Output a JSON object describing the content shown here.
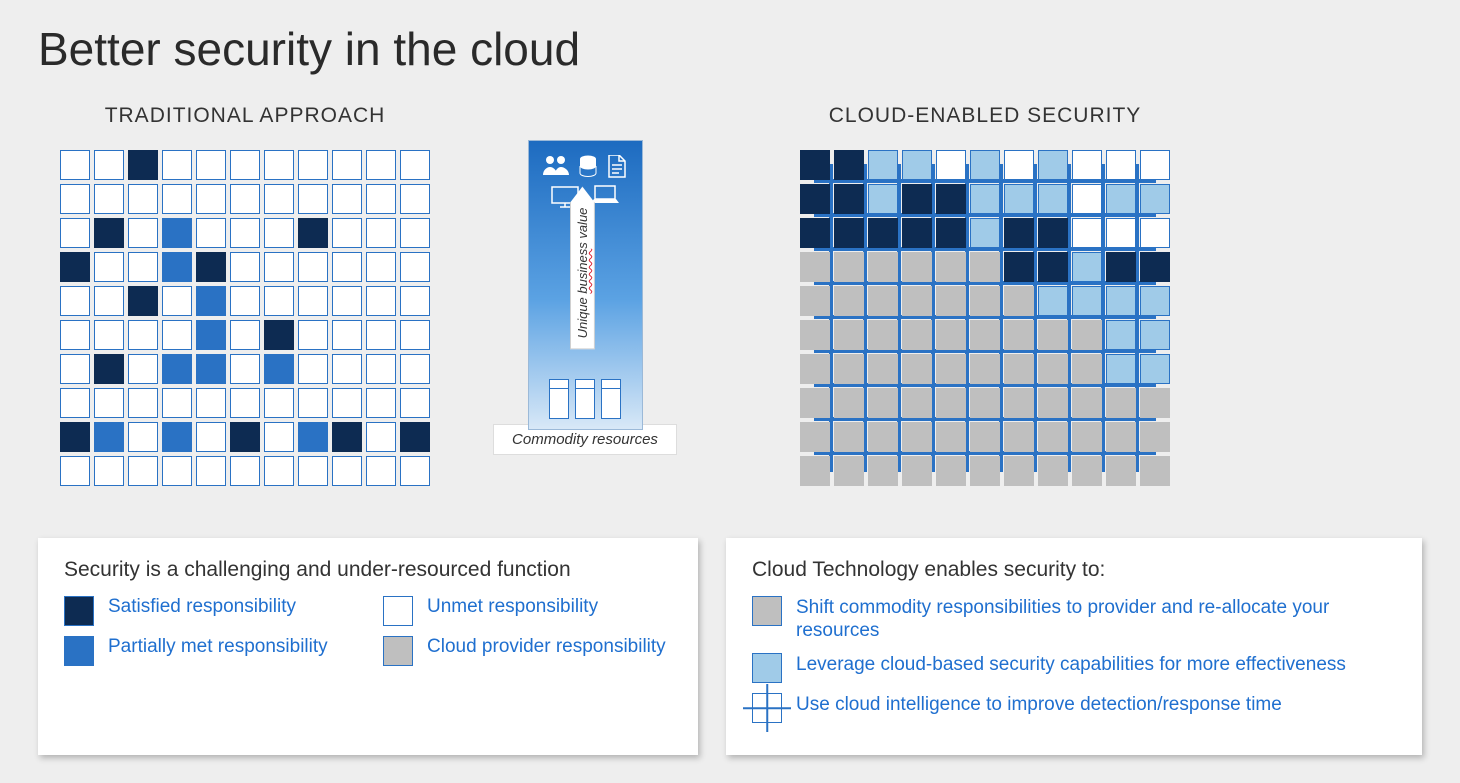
{
  "title": "Better security in the cloud",
  "columns": {
    "traditional": "TRADITIONAL APPROACH",
    "cloud": "CLOUD-ENABLED SECURITY"
  },
  "middle": {
    "vertical_label_prefix": "Unique ",
    "vertical_label_squiggle": "busines",
    "vertical_label_suffix": "s value",
    "commodity_label": "Commodity resources"
  },
  "left_card": {
    "title": "Security is a challenging and under-resourced function",
    "legend": [
      {
        "key": "satisfied",
        "label": "Satisfied responsibility",
        "swatch": "c-s"
      },
      {
        "key": "partial",
        "label": "Partially met responsibility",
        "swatch": "c-p"
      },
      {
        "key": "unmet",
        "label": "Unmet responsibility",
        "swatch": "c-u"
      },
      {
        "key": "provider",
        "label": "Cloud provider responsibility",
        "swatch": "c-g"
      }
    ]
  },
  "right_card": {
    "title": "Cloud Technology enables security to:",
    "bullets": [
      {
        "swatch": "c-g",
        "label": "Shift commodity responsibilities to provider and re-allocate your resources"
      },
      {
        "swatch": "c-l",
        "label": "Leverage cloud-based security capabilities for more effectiveness"
      },
      {
        "swatch": "intel",
        "label": "Use cloud intelligence to improve detection/response time"
      }
    ]
  },
  "grids": {
    "traditional": [
      [
        "u",
        "u",
        "s",
        "u",
        "u",
        "u",
        "u",
        "u",
        "u",
        "u",
        "u"
      ],
      [
        "u",
        "u",
        "u",
        "u",
        "u",
        "u",
        "u",
        "u",
        "u",
        "u",
        "u"
      ],
      [
        "u",
        "s",
        "u",
        "p",
        "u",
        "u",
        "u",
        "s",
        "u",
        "u",
        "u"
      ],
      [
        "s",
        "u",
        "u",
        "p",
        "s",
        "u",
        "u",
        "u",
        "u",
        "u",
        "u"
      ],
      [
        "u",
        "u",
        "s",
        "u",
        "p",
        "u",
        "u",
        "u",
        "u",
        "u",
        "u"
      ],
      [
        "u",
        "u",
        "u",
        "u",
        "p",
        "u",
        "s",
        "u",
        "u",
        "u",
        "u"
      ],
      [
        "u",
        "s",
        "u",
        "p",
        "p",
        "u",
        "p",
        "u",
        "u",
        "u",
        "u"
      ],
      [
        "u",
        "u",
        "u",
        "u",
        "u",
        "u",
        "u",
        "u",
        "u",
        "u",
        "u"
      ],
      [
        "s",
        "p",
        "u",
        "p",
        "u",
        "s",
        "u",
        "p",
        "s",
        "u",
        "s"
      ],
      [
        "u",
        "u",
        "u",
        "u",
        "u",
        "u",
        "u",
        "u",
        "u",
        "u",
        "u"
      ]
    ],
    "cloud": [
      [
        "s",
        "s",
        "l",
        "l",
        "u",
        "l",
        "u",
        "l",
        "u",
        "u",
        "u"
      ],
      [
        "s",
        "s",
        "l",
        "s",
        "s",
        "l",
        "l",
        "l",
        "u",
        "l",
        "l"
      ],
      [
        "s",
        "s",
        "s",
        "s",
        "s",
        "l",
        "s",
        "s",
        "i",
        "i",
        "u"
      ],
      [
        "g",
        "g",
        "g",
        "g",
        "g",
        "g",
        "s",
        "s",
        "l",
        "s",
        "s"
      ],
      [
        "g",
        "g",
        "g",
        "g",
        "g",
        "g",
        "g",
        "l",
        "l",
        "l",
        "l"
      ],
      [
        "g",
        "g",
        "g",
        "g",
        "g",
        "g",
        "g",
        "g",
        "g",
        "l",
        "l"
      ],
      [
        "g",
        "g",
        "g",
        "g",
        "g",
        "g",
        "g",
        "g",
        "g",
        "l",
        "l"
      ],
      [
        "g",
        "g",
        "g",
        "g",
        "g",
        "g",
        "g",
        "g",
        "g",
        "g",
        "g"
      ],
      [
        "g",
        "g",
        "g",
        "g",
        "g",
        "g",
        "g",
        "g",
        "g",
        "g",
        "g"
      ],
      [
        "g",
        "g",
        "g",
        "g",
        "g",
        "g",
        "g",
        "g",
        "g",
        "g",
        "g"
      ]
    ]
  },
  "colors": {
    "unmet": "#ffffff",
    "satisfied": "#0d2b52",
    "partial": "#2a72c4",
    "provider": "#bfbfbf",
    "leverage": "#a0cbe8",
    "accent": "#1f6fcf"
  }
}
